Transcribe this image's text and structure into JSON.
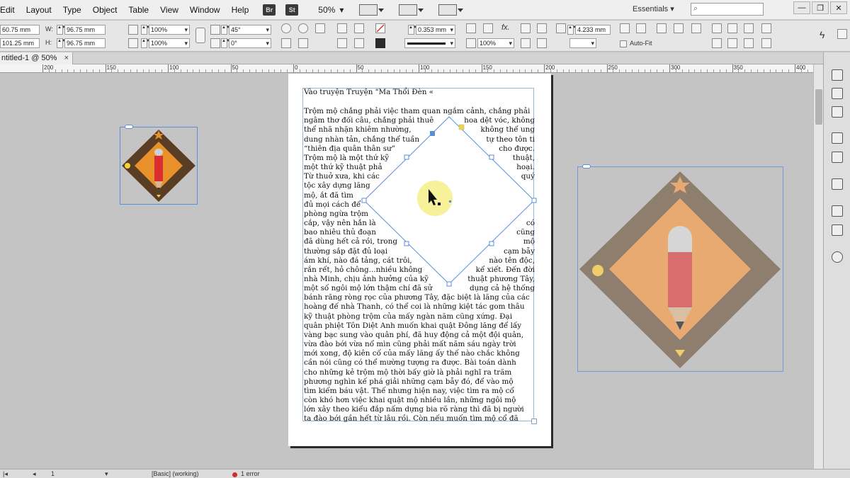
{
  "menu": {
    "items": [
      "Edit",
      "Layout",
      "Type",
      "Object",
      "Table",
      "View",
      "Window",
      "Help"
    ],
    "bridge_badge": "Br",
    "stock_badge": "St",
    "zoom": "50%",
    "workspace": "Essentials",
    "search_placeholder": ""
  },
  "window_buttons": {
    "minimize": "—",
    "restore": "❐",
    "close": "✕"
  },
  "control": {
    "x_value": "60.75 mm",
    "y_value": "101.25 mm",
    "w_label": "W:",
    "h_label": "H:",
    "w_value": "96.75 mm",
    "h_value": "96.75 mm",
    "scale_x": "100%",
    "scale_y": "100%",
    "rotation": "45°",
    "shear": "0°",
    "stroke_weight": "0.353 mm",
    "opacity": "100%",
    "dimension": "4.233 mm",
    "auto_fit": "Auto-Fit"
  },
  "document": {
    "tab_title": "ntitled-1 @ 50%",
    "close": "×"
  },
  "ruler": {
    "labels": [
      "200",
      "150",
      "100",
      "50",
      "0",
      "50",
      "100",
      "150",
      "200",
      "250",
      "300",
      "350",
      "400"
    ]
  },
  "page_text": {
    "title": "Vào truyện Truyện \"Ma Thổi Đèn «",
    "lines_full_top": [
      "Trộm mộ chẳng phải việc tham quan ngắm cảnh, chẳng phải"
    ],
    "lines_split": [
      [
        "ngâm thơ đối câu, chẳng phải thuê",
        "hoa dệt vóc, không"
      ],
      [
        "thể nhã nhặn khiêm nhường,",
        "không thể ung"
      ],
      [
        "dung nhàn tản, chẳng thể tuần",
        "tự theo tôn ti"
      ],
      [
        "“thiên địa quân thân sư”",
        "cho được."
      ],
      [
        "Trộm mộ là một thứ kỹ",
        "thuật,"
      ],
      [
        "một thứ kỹ thuật phả",
        "hoại."
      ],
      [
        "Từ thuở xưa, khi các",
        "quý"
      ],
      [
        "tộc xây dựng lăng",
        ""
      ],
      [
        "mộ, ắt đã tìm",
        ""
      ],
      [
        "đủ mọi cách để",
        ""
      ],
      [
        "phòng ngừa trộm",
        ""
      ],
      [
        "cắp, vậy nên hẳn là",
        "có"
      ],
      [
        "bao nhiêu thủ đoạn",
        "cũng"
      ],
      [
        "đã dùng hết cả rồi, trong",
        "mộ"
      ],
      [
        "thường sắp đặt đủ loại",
        "cạm bẫy"
      ],
      [
        "ám khí, nào đá tảng, cát trôi,",
        "nào tên độc,"
      ],
      [
        "rắn rết, hỏ chông...nhiều không",
        "kể xiết. Đến đời"
      ],
      [
        "nhà Minh, chịu ảnh hưởng của kỹ",
        "thuật phương Tây,"
      ],
      [
        "một số ngôi mộ lớn thậm chí đã sử",
        "dụng cả hệ thống"
      ]
    ],
    "lines_full_bottom": [
      "bánh răng ròng rọc của phương Tây, đặc biệt là lăng của các",
      "hoàng đế nhà Thanh, có thể coi là những kiệt tác gom thâu",
      "kỹ thuật phòng trộm của mấy ngàn năm cũng xứng. Đại",
      "quân phiệt Tôn Diệt Anh muốn khai quật Đông lăng để lấy",
      "vàng bạc sung vào quân phí, đã huy động cả một đội quân,",
      "vừa đào bới vừa nổ mìn cũng phải mất năm sáu ngày trời",
      "mới xong, độ kiên cố của mấy lăng ấy thế nào chắc không",
      "cần nói cũng có thể mường tượng ra được. Bài toán dành",
      "cho những kẻ trộm mộ thời bấy giờ là phải nghĩ ra trăm",
      "phương nghìn kế phá giải những cạm bẫy đó, để vào mộ",
      "tìm kiếm báu vật. Thế nhưng hiện nay, việc tìm ra mộ cổ",
      "còn khó hơn việc khai quật mộ nhiều lần, những ngôi mộ",
      "lớn xây theo kiểu đắp nấm dựng bia rõ ràng thì đã bị người",
      "ta đào bới gần hết từ lâu rồi. Còn nếu muốn tìm mộ cổ đã"
    ]
  },
  "status": {
    "page": "1",
    "preflight": "[Basic] (working)",
    "errors": "1 error"
  },
  "colors": {
    "diamond_outer": "#5a3d25",
    "diamond_inner": "#e8902a",
    "pencil_red": "#d9302f",
    "accent_yellow": "#f2d53a",
    "selection_blue": "#5b8ed8",
    "cursor_highlight": "#f7f299"
  }
}
